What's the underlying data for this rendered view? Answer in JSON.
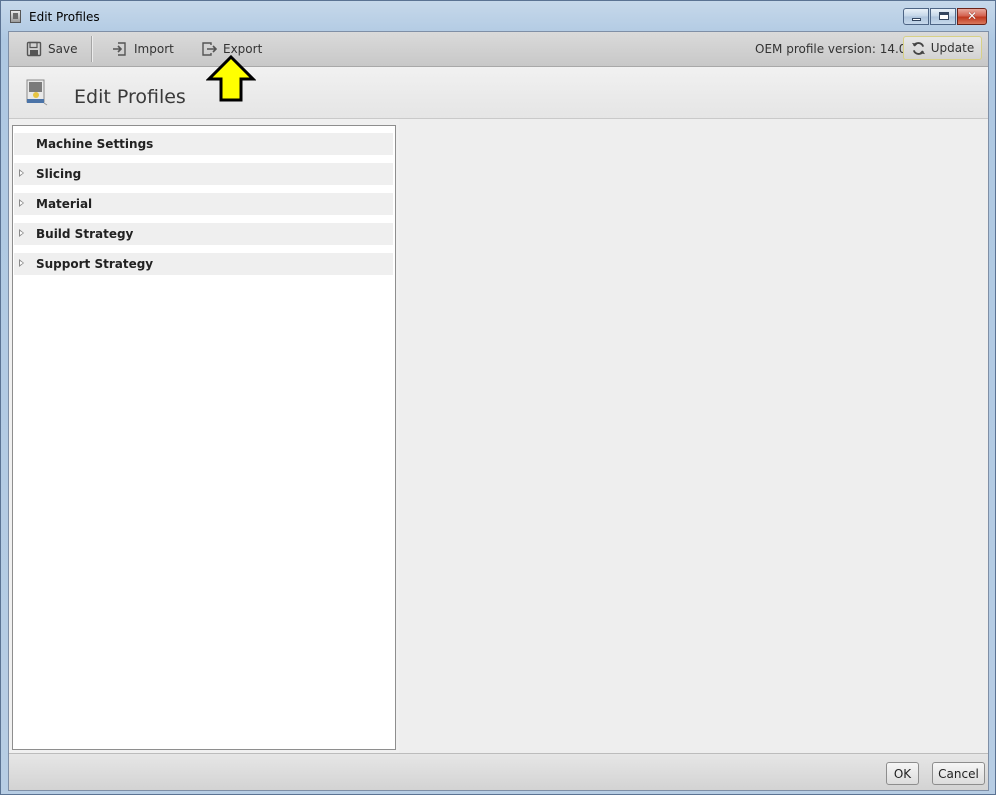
{
  "window": {
    "title": "Edit Profiles",
    "controls": {
      "minimize": "minimize",
      "maximize": "maximize",
      "close": "✕"
    }
  },
  "toolbar": {
    "save_label": "Save",
    "import_label": "Import",
    "export_label": "Export",
    "oem_version": "OEM profile version: 14.0",
    "update_label": "Update"
  },
  "header": {
    "title": "Edit Profiles"
  },
  "tree": {
    "items": [
      {
        "label": "Machine Settings",
        "expandable": false
      },
      {
        "label": "Slicing",
        "expandable": true
      },
      {
        "label": "Material",
        "expandable": true
      },
      {
        "label": "Build Strategy",
        "expandable": true
      },
      {
        "label": "Support Strategy",
        "expandable": true
      }
    ]
  },
  "footer": {
    "ok_label": "OK",
    "cancel_label": "Cancel"
  },
  "annotation": {
    "arrow_color": "#ffff00",
    "points_to": "export"
  },
  "icons": [
    "app-icon",
    "save-icon",
    "import-icon",
    "export-icon",
    "refresh-icon",
    "printer-icon"
  ]
}
